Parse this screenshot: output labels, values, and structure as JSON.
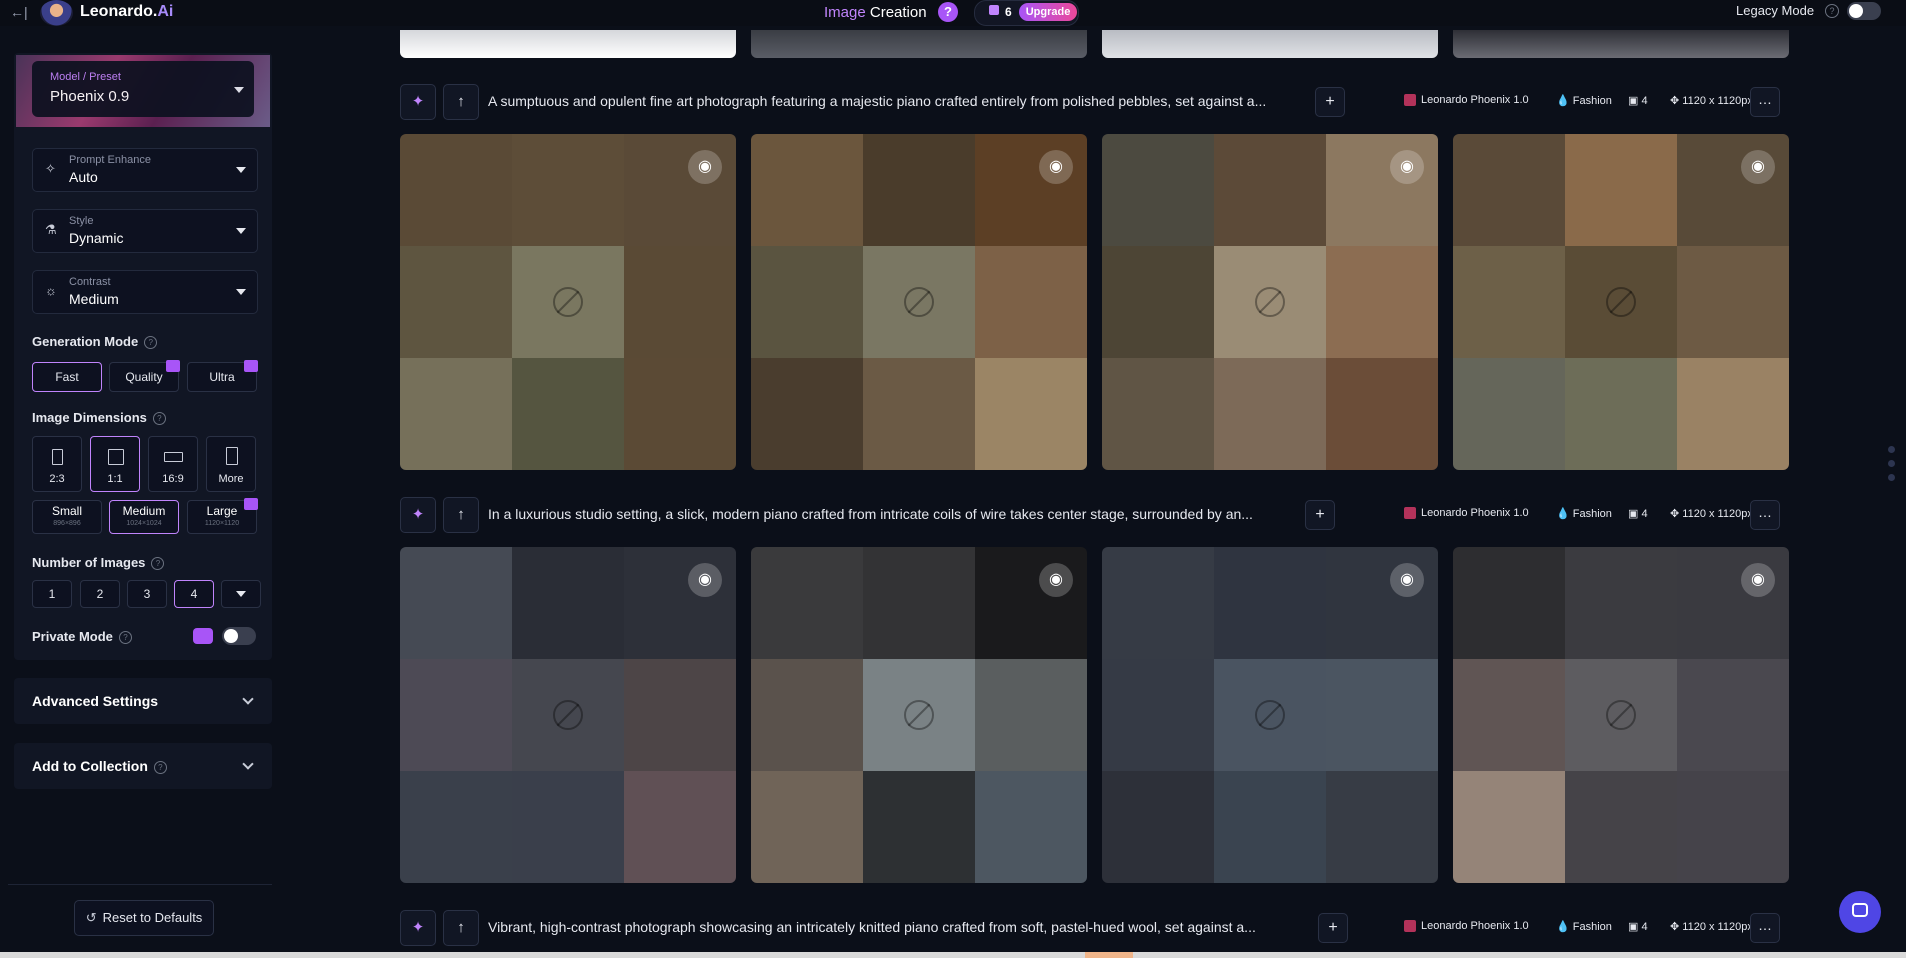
{
  "header": {
    "back_icon": "←|",
    "brand_name": "Leonardo.",
    "brand_suffix": "Ai",
    "title_highlight": "Image",
    "title_rest": " Creation",
    "help_label": "?",
    "token_count": "6",
    "upgrade_label": "Upgrade",
    "legacy_mode_label": "Legacy Mode",
    "legacy_mode_on": false
  },
  "sidebar": {
    "model": {
      "label": "Model / Preset",
      "value": "Phoenix 0.9"
    },
    "prompt_enhance": {
      "label": "Prompt Enhance",
      "value": "Auto"
    },
    "style": {
      "label": "Style",
      "value": "Dynamic"
    },
    "contrast": {
      "label": "Contrast",
      "value": "Medium"
    },
    "generation_mode": {
      "title": "Generation Mode",
      "options": [
        {
          "label": "Fast",
          "active": true,
          "premium": false
        },
        {
          "label": "Quality",
          "active": false,
          "premium": true
        },
        {
          "label": "Ultra",
          "active": false,
          "premium": true
        }
      ]
    },
    "image_dimensions": {
      "title": "Image Dimensions",
      "ratios": [
        {
          "label": "2:3",
          "active": false
        },
        {
          "label": "1:1",
          "active": true
        },
        {
          "label": "16:9",
          "active": false
        },
        {
          "label": "More",
          "active": false
        }
      ],
      "sizes": [
        {
          "label": "Small",
          "sub": "896×896",
          "active": false,
          "premium": false
        },
        {
          "label": "Medium",
          "sub": "1024×1024",
          "active": true,
          "premium": false
        },
        {
          "label": "Large",
          "sub": "1120×1120",
          "active": false,
          "premium": true
        }
      ]
    },
    "number_of_images": {
      "title": "Number of Images",
      "options": [
        "1",
        "2",
        "3",
        "4"
      ],
      "selected": "4"
    },
    "private_mode": {
      "label": "Private Mode",
      "on": false
    },
    "advanced_settings": "Advanced Settings",
    "add_to_collection": "Add to Collection",
    "reset_label": "Reset to Defaults"
  },
  "generations": [
    {
      "prompt": "A sumptuous and opulent fine art photograph featuring a majestic piano crafted entirely from polished pebbles, set against a...",
      "model": "Leonardo Phoenix 1.0",
      "style": "Fashion",
      "count": "4",
      "dimensions": "1120 x 1120px"
    },
    {
      "prompt": "In a luxurious studio setting, a slick, modern piano crafted from intricate coils of wire takes center stage, surrounded by an...",
      "model": "Leonardo Phoenix 1.0",
      "style": "Fashion",
      "count": "4",
      "dimensions": "1120 x 1120px"
    },
    {
      "prompt": "Vibrant, high-contrast photograph showcasing an intricately knitted piano crafted from soft, pastel-hued wool, set against a...",
      "model": "Leonardo Phoenix 1.0",
      "style": "Fashion",
      "count": "4",
      "dimensions": "1120 x 1120px"
    }
  ],
  "image_colors": {
    "row1": [
      [
        "#5a4a36",
        "#5d4d38",
        "#5a4a37",
        "#5e5540",
        "#7a7760",
        "#5a4a35",
        "#76705a",
        "#555540",
        "#5b4a35"
      ],
      [
        "#6b563d",
        "#4a3c2b",
        "#5c3f25",
        "#5a5440",
        "#7a7763",
        "#7d6147",
        "#4a3d2e",
        "#6b5a45",
        "#9b8565"
      ],
      [
        "#4c4a40",
        "#5c4a38",
        "#8c7860",
        "#4d4535",
        "#9a8c75",
        "#8c6d52",
        "#605545",
        "#7d6a58",
        "#6b4d38"
      ],
      [
        "#5a4a38",
        "#8a6a4a",
        "#584a38",
        "#6d6048",
        "#5a4c36",
        "#6d5a44",
        "#65665a",
        "#6d6d58",
        "#9a8264"
      ]
    ],
    "row2": [
      [
        "#454a54",
        "#2a2d36",
        "#2d3039",
        "#4d4a55",
        "#45474f",
        "#4d4547",
        "#3a404b",
        "#3a3f4b",
        "#605055"
      ],
      [
        "#3a3a3c",
        "#333335",
        "#1a1a1c",
        "#5a524c",
        "#7a8285",
        "#5a5e5f",
        "#706458",
        "#2d3033",
        "#4d5761"
      ],
      [
        "#363b45",
        "#2f3440",
        "#30353f",
        "#353a45",
        "#4a5461",
        "#4b5561",
        "#2d3039",
        "#3a4450",
        "#373c45"
      ],
      [
        "#2d2d30",
        "#3b3b40",
        "#3a3a40",
        "#605554",
        "#5d5c60",
        "#4a484f",
        "#958478",
        "#454348",
        "#45434a"
      ]
    ]
  }
}
